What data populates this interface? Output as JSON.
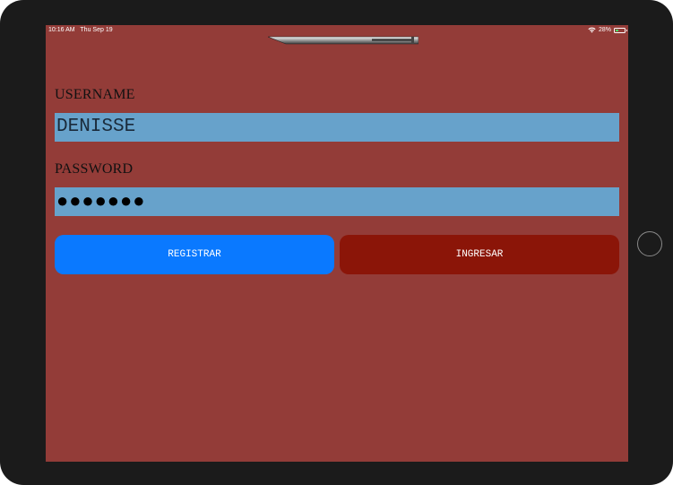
{
  "status_bar": {
    "time": "10:16 AM",
    "date": "Thu Sep 19",
    "battery_percent": "28%",
    "battery_level": 0.28,
    "icons": [
      "wifi-icon",
      "battery-icon"
    ]
  },
  "login_form": {
    "username_label": "USERNAME",
    "username_value": "DENISSE",
    "password_label": "PASSWORD",
    "password_value": "●●●●●●●"
  },
  "buttons": {
    "register_label": "REGISTRAR",
    "login_label": "INGRESAR"
  },
  "colors": {
    "screen_background": "#933c38",
    "field_background": "#67a2cb",
    "register_button": "#0a79ff",
    "login_button": "#8b1508",
    "device_bezel": "#1b1b1b"
  }
}
